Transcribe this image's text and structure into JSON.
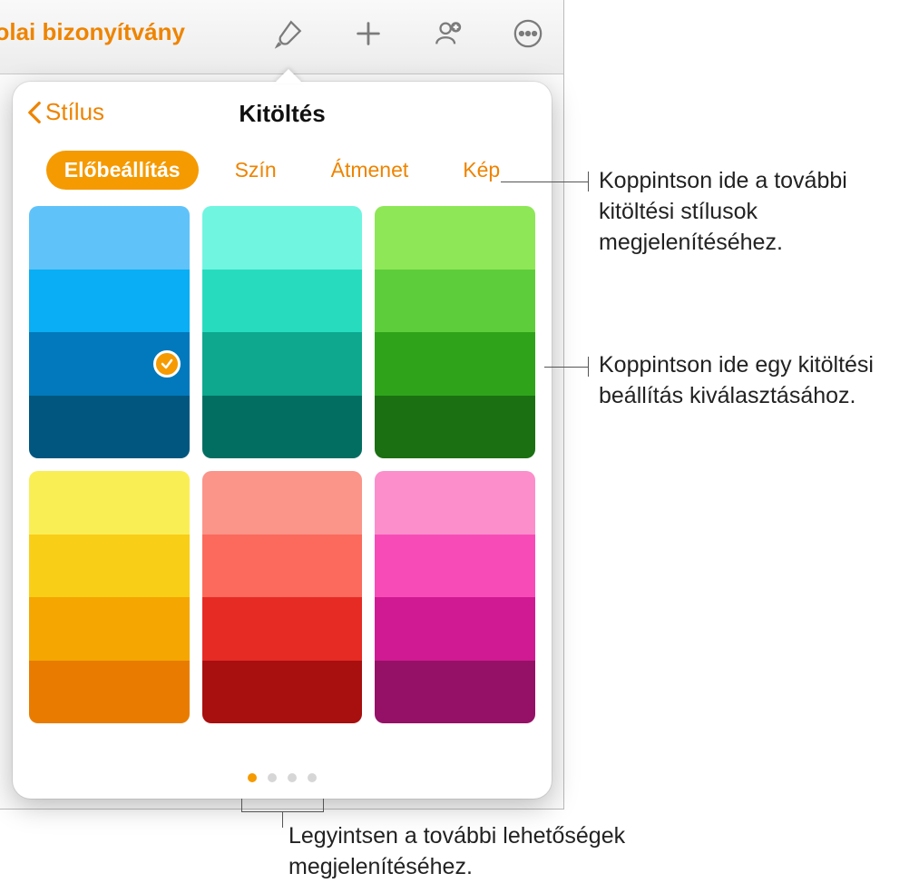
{
  "toolbar": {
    "doc_title": "kolai bizonyítvány"
  },
  "popover": {
    "back_label": "Stílus",
    "title": "Kitöltés",
    "tabs": {
      "preset": "Előbeállítás",
      "color": "Szín",
      "gradient": "Átmenet",
      "image": "Kép"
    }
  },
  "swatches": {
    "group0": [
      "#5FC3FA",
      "#09AEF4",
      "#0279BC",
      "#00567F"
    ],
    "group1": [
      "#70F5E1",
      "#27DCBE",
      "#0DA88E",
      "#026E61"
    ],
    "group2": [
      "#8EE757",
      "#5ECD3B",
      "#2FA41A",
      "#1B7012"
    ],
    "group3": [
      "#FAEE55",
      "#F9CE16",
      "#F5A601",
      "#E97C00"
    ],
    "group4": [
      "#FB9489",
      "#FB6A5C",
      "#E62B24",
      "#A80F0F"
    ],
    "group5": [
      "#FB8ECB",
      "#F74CB7",
      "#D01A93",
      "#951167"
    ]
  },
  "selected": {
    "group": 0,
    "index": 2
  },
  "pager": {
    "pages": 4,
    "active": 0
  },
  "callouts": {
    "tabs": "Koppintson ide a további kitöltési stílusok megjelenítéséhez.",
    "swatch": "Koppintson ide egy kitöltési beállítás kiválasztásához.",
    "pager": "Legyintsen a további lehetőségek megjelenítéséhez."
  }
}
